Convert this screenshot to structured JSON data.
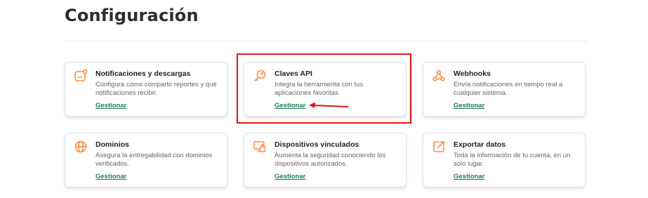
{
  "page": {
    "title": "Configuración"
  },
  "cards": [
    {
      "title": "Notificaciones y descargas",
      "description": "Configura cómo compartir reportes y qué notificaciones recibir.",
      "link": "Gestionar",
      "icon": "notification-card-icon"
    },
    {
      "title": "Claves API",
      "description": "Integra la herramienta con tus aplicaciones favoritas.",
      "link": "Gestionar",
      "icon": "key-icon"
    },
    {
      "title": "Webhooks",
      "description": "Envía notificaciones en tiempo real a cualquier sistema.",
      "link": "Gestionar",
      "icon": "webhook-icon"
    },
    {
      "title": "Dominios",
      "description": "Asegura la entregabilidad con dominios verificados.",
      "link": "Gestionar",
      "icon": "globe-icon"
    },
    {
      "title": "Dispositivos vinculados",
      "description": "Aumenta la seguridad conociendo los dispositivos autorizados.",
      "link": "Gestionar",
      "icon": "devices-lock-icon"
    },
    {
      "title": "Exportar datos",
      "description": "Toda la información de tu cuenta, en un solo lugar.",
      "link": "Gestionar",
      "icon": "export-icon"
    }
  ],
  "colors": {
    "accent": "#ff8a3d",
    "link": "#1e7d52",
    "highlight": "#e11717"
  }
}
